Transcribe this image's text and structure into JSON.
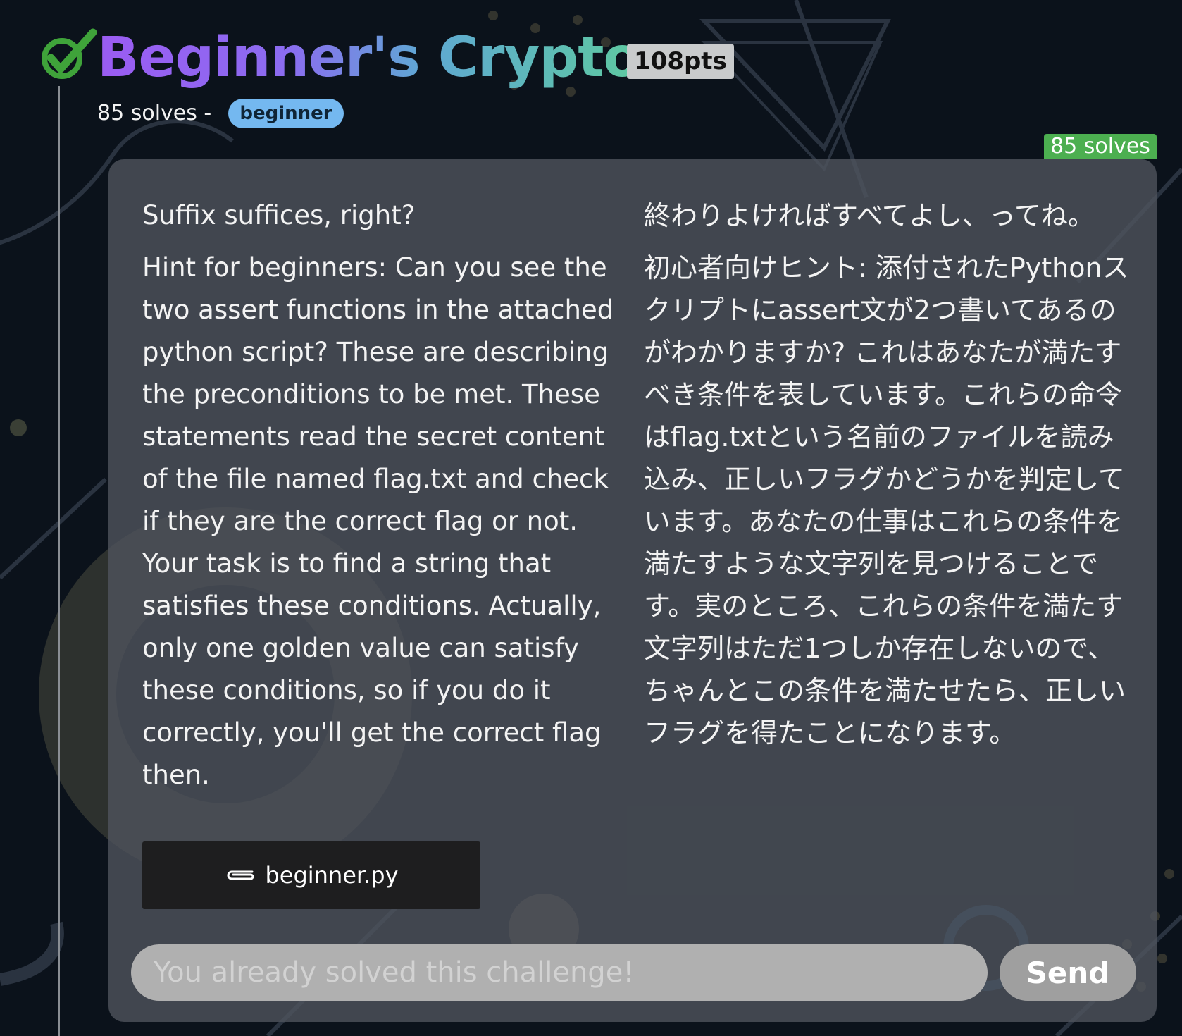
{
  "challenge": {
    "title": "Beginner's Crypto",
    "points": "108pts",
    "solves_text": "85 solves -",
    "tag": "beginner",
    "solves_badge": "85 solves"
  },
  "description": {
    "en_lead": "Suffix suffices, right?",
    "en_hint": "Hint for beginners: Can you see the two assert functions in the attached python script? These are describing the preconditions to be met. These statements read the secret content of the file named flag.txt and check if they are the correct flag or not. Your task is to find a string that satisfies these conditions. Actually, only one golden value can satisfy these conditions, so if you do it correctly, you'll get the correct flag then.",
    "ja_lead": "終わりよければすべてよし、ってね。",
    "ja_hint": "初心者向けヒント: 添付されたPythonスクリプトにassert文が2つ書いてあるのがわかりますか? これはあなたが満たすべき条件を表しています。これらの命令はflag.txtという名前のファイルを読み込み、正しいフラグかどうかを判定しています。あなたの仕事はこれらの条件を満たすような文字列を見つけることです。実のところ、これらの条件を満たす文字列はただ1つしか存在しないので、ちゃんとこの条件を満たせたら、正しいフラグを得たことになります。"
  },
  "attachment": {
    "filename": "beginner.py",
    "icon": "paperclip-icon"
  },
  "submission": {
    "placeholder": "You already solved this challenge!",
    "send_label": "Send"
  },
  "colors": {
    "background": "#0b121b",
    "solved_check": "#3fa33a",
    "tag": "#74b8f0",
    "solves_badge": "#4caf50",
    "card": "#4f545c"
  }
}
